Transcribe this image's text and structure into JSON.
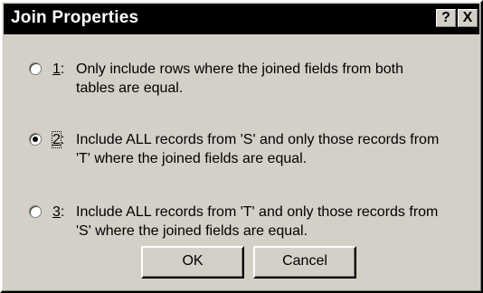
{
  "window": {
    "title": "Join Properties",
    "help_label": "?",
    "close_label": "X"
  },
  "options": [
    {
      "key": "1",
      "text_line1": "Only include rows where the joined fields from both",
      "text_line2": "tables are equal.",
      "selected": false
    },
    {
      "key": "2",
      "text_line1": "Include ALL records from 'S' and only those records from",
      "text_line2": "'T' where the joined fields are equal.",
      "selected": true
    },
    {
      "key": "3",
      "text_line1": "Include ALL records from 'T' and only those records from",
      "text_line2": "'S' where the joined fields are equal.",
      "selected": false
    }
  ],
  "buttons": {
    "ok_label": "OK",
    "cancel_label": "Cancel"
  },
  "colors": {
    "dialog_bg": "#d4d0c8",
    "title_bg": "#000000",
    "title_text": "#ffffff"
  }
}
